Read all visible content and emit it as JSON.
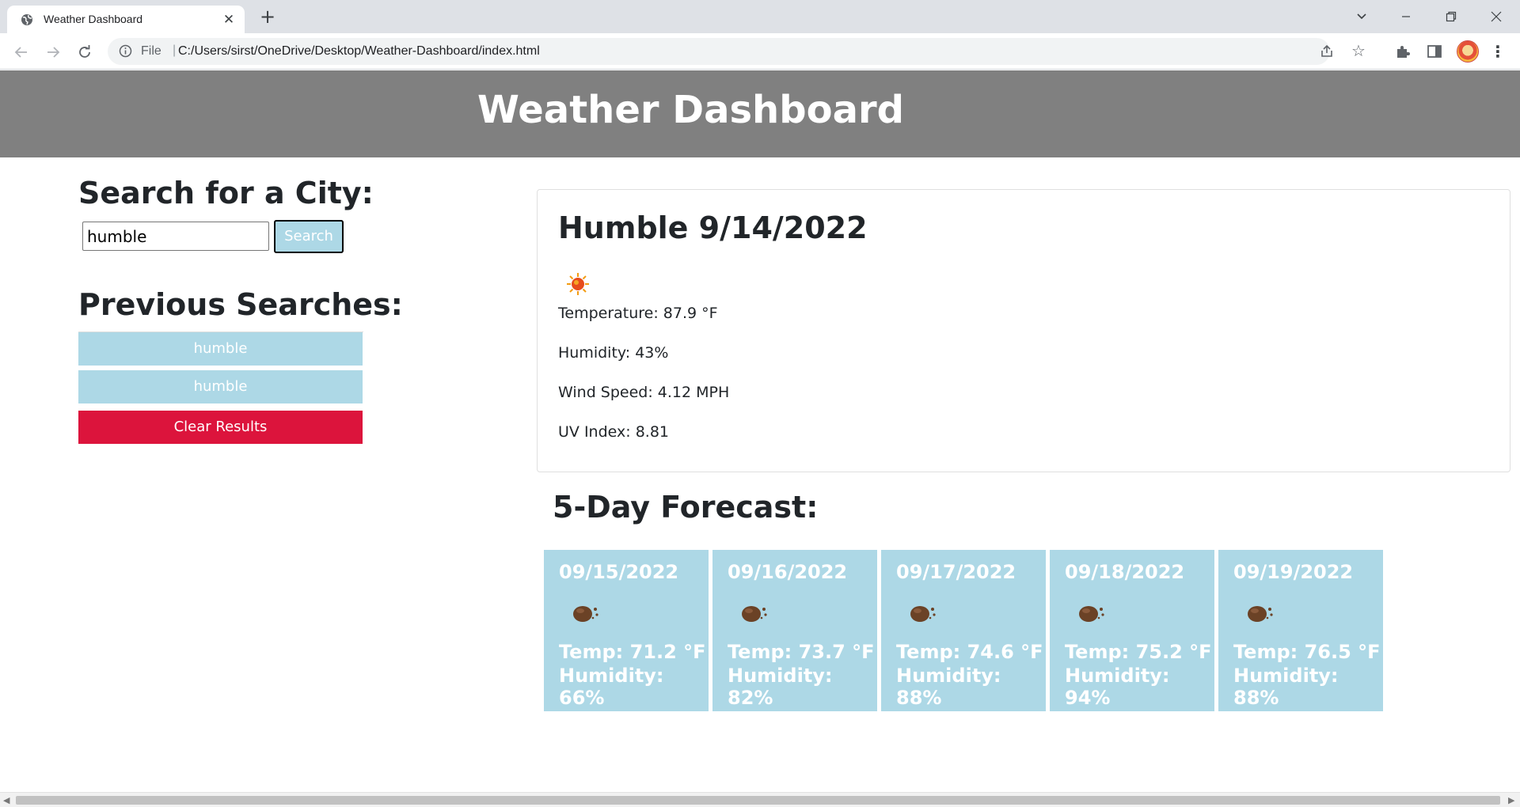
{
  "browser": {
    "tab_title": "Weather Dashboard",
    "tab_close": "✕",
    "new_tab": "+",
    "address_scheme": "File",
    "address_separator": "|",
    "address_url": "C:/Users/sirst/OneDrive/Desktop/Weather-Dashboard/index.html",
    "menu": "⋮"
  },
  "header": {
    "title": "Weather Dashboard",
    "background_color": "#808080"
  },
  "search": {
    "heading": "Search for a City:",
    "input_value": "humble",
    "button_label": "Search",
    "button_color": "#add8e6"
  },
  "previous": {
    "heading": "Previous Searches:",
    "items": [
      {
        "label": "humble"
      },
      {
        "label": "humble"
      }
    ],
    "clear_label": "Clear Results",
    "clear_color": "#dc143c"
  },
  "current": {
    "title": "Humble 9/14/2022",
    "icon": "sun-icon",
    "temperature": "Temperature: 87.9 °F",
    "humidity": "Humidity: 43%",
    "wind": "Wind Speed: 4.12 MPH",
    "uv": "UV Index: 8.81"
  },
  "forecast": {
    "heading": "5-Day Forecast:",
    "card_color": "#add8e6",
    "days": [
      {
        "date": "09/15/2022",
        "icon": "rain-cloud-icon",
        "temp": "Temp: 71.2 °F",
        "humidity": "Humidity: 66%"
      },
      {
        "date": "09/16/2022",
        "icon": "rain-cloud-icon",
        "temp": "Temp: 73.7 °F",
        "humidity": "Humidity: 82%"
      },
      {
        "date": "09/17/2022",
        "icon": "rain-cloud-icon",
        "temp": "Temp: 74.6 °F",
        "humidity": "Humidity: 88%"
      },
      {
        "date": "09/18/2022",
        "icon": "rain-cloud-icon",
        "temp": "Temp: 75.2 °F",
        "humidity": "Humidity: 94%"
      },
      {
        "date": "09/19/2022",
        "icon": "rain-cloud-icon",
        "temp": "Temp: 76.5 °F",
        "humidity": "Humidity: 88%"
      }
    ]
  }
}
